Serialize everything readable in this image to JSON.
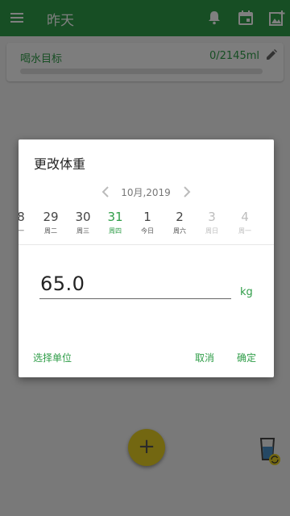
{
  "appbar": {
    "title": "昨天"
  },
  "goal": {
    "label": "喝水目标",
    "value": "0/2145ml",
    "progress": 0
  },
  "dialog": {
    "title": "更改体重",
    "month": "10月,2019",
    "dates": [
      {
        "num": "8",
        "wk": "一",
        "state": "normal"
      },
      {
        "num": "29",
        "wk": "周二",
        "state": "normal"
      },
      {
        "num": "30",
        "wk": "周三",
        "state": "normal"
      },
      {
        "num": "31",
        "wk": "周四",
        "state": "selected"
      },
      {
        "num": "1",
        "wk": "今日",
        "state": "normal"
      },
      {
        "num": "2",
        "wk": "周六",
        "state": "normal"
      },
      {
        "num": "3",
        "wk": "周日",
        "state": "future"
      },
      {
        "num": "4",
        "wk": "周一",
        "state": "future"
      }
    ],
    "weight": "65.0",
    "unit": "kg",
    "select_unit": "选择单位",
    "cancel": "取消",
    "confirm": "确定"
  },
  "fab": {
    "label": "+"
  },
  "colors": {
    "accent": "#2f9d48",
    "fab": "#e6cf22"
  }
}
